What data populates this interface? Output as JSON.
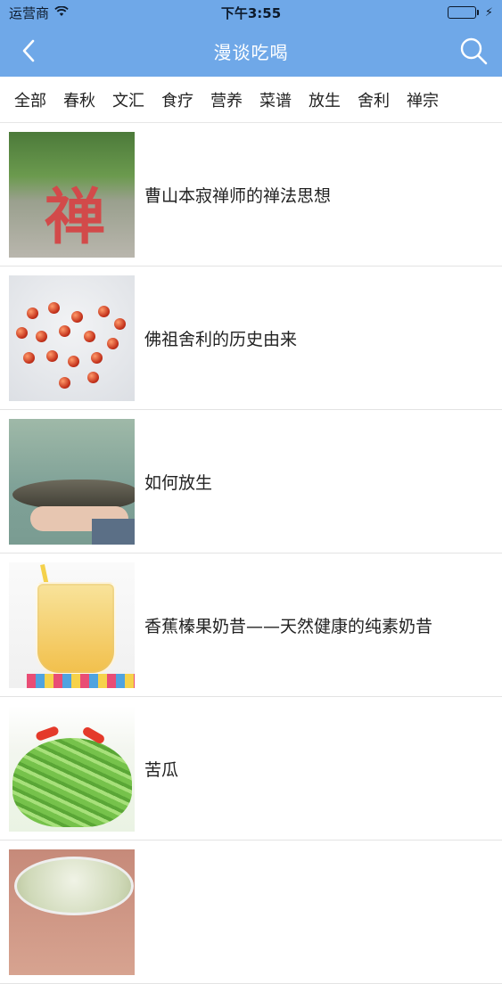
{
  "status_bar": {
    "carrier": "运营商",
    "time": "下午3:55",
    "battery_level": 1.0
  },
  "nav": {
    "title": "漫谈吃喝",
    "back_icon": "chevron-left-icon",
    "search_icon": "search-icon"
  },
  "tabs": [
    "全部",
    "春秋",
    "文汇",
    "食疗",
    "营养",
    "菜谱",
    "放生",
    "舍利",
    "禅宗"
  ],
  "articles": [
    {
      "title": "曹山本寂禅师的禅法思想"
    },
    {
      "title": "佛祖舍利的历史由来"
    },
    {
      "title": "如何放生"
    },
    {
      "title": "香蕉榛果奶昔——天然健康的纯素奶昔"
    },
    {
      "title": "苦瓜"
    },
    {
      "title": ""
    }
  ],
  "thumb_glyph": "禅",
  "colors": {
    "nav_bg": "#6fa8e8",
    "battery_fill": "#2ecc40"
  }
}
